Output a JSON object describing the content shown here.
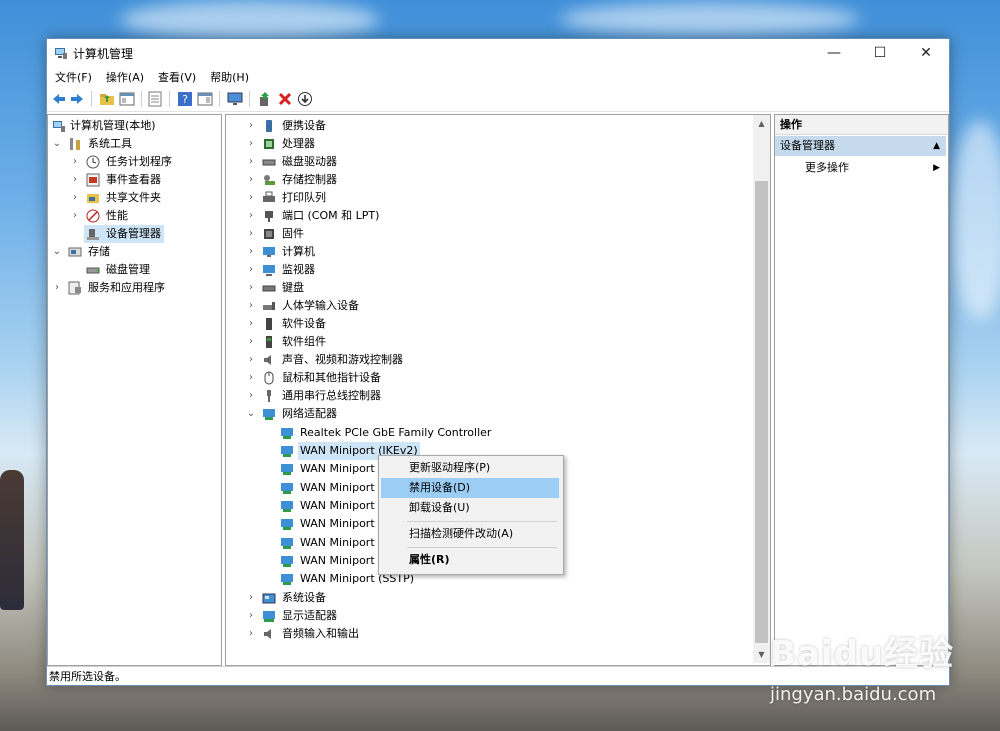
{
  "window": {
    "title": "计算机管理"
  },
  "menubar": [
    "文件(F)",
    "操作(A)",
    "查看(V)",
    "帮助(H)"
  ],
  "left_tree": [
    {
      "label": "计算机管理(本地)"
    },
    {
      "label": "系统工具"
    },
    {
      "label": "任务计划程序"
    },
    {
      "label": "事件查看器"
    },
    {
      "label": "共享文件夹"
    },
    {
      "label": "性能"
    },
    {
      "label": "设备管理器"
    },
    {
      "label": "存储"
    },
    {
      "label": "磁盘管理"
    },
    {
      "label": "服务和应用程序"
    }
  ],
  "device_tree": [
    {
      "label": "便携设备"
    },
    {
      "label": "处理器"
    },
    {
      "label": "磁盘驱动器"
    },
    {
      "label": "存储控制器"
    },
    {
      "label": "打印队列"
    },
    {
      "label": "端口 (COM 和 LPT)"
    },
    {
      "label": "固件"
    },
    {
      "label": "计算机"
    },
    {
      "label": "监视器"
    },
    {
      "label": "键盘"
    },
    {
      "label": "人体学输入设备"
    },
    {
      "label": "软件设备"
    },
    {
      "label": "软件组件"
    },
    {
      "label": "声音、视频和游戏控制器"
    },
    {
      "label": "鼠标和其他指针设备"
    },
    {
      "label": "通用串行总线控制器"
    },
    {
      "label": "网络适配器"
    },
    {
      "label": "Realtek PCIe GbE Family Controller"
    },
    {
      "label": "WAN Miniport (IKEv2)"
    },
    {
      "label": "WAN Miniport"
    },
    {
      "label": "WAN Miniport"
    },
    {
      "label": "WAN Miniport"
    },
    {
      "label": "WAN Miniport"
    },
    {
      "label": "WAN Miniport"
    },
    {
      "label": "WAN Miniport"
    },
    {
      "label": "WAN Miniport (SSTP)"
    },
    {
      "label": "系统设备"
    },
    {
      "label": "显示适配器"
    },
    {
      "label": "音频输入和输出"
    }
  ],
  "actions_pane": {
    "header": "操作",
    "section": "设备管理器",
    "more": "更多操作"
  },
  "context_menu": [
    "更新驱动程序(P)",
    "禁用设备(D)",
    "卸载设备(U)",
    "扫描检测硬件改动(A)",
    "属性(R)"
  ],
  "status_text": "禁用所选设备。",
  "watermark": {
    "brand": "Baidu经验",
    "url": "jingyan.baidu.com"
  },
  "colors": {
    "selection": "#cde5f7",
    "menu_highlight": "#9ccdf4",
    "actions_section": "#c5daec"
  }
}
